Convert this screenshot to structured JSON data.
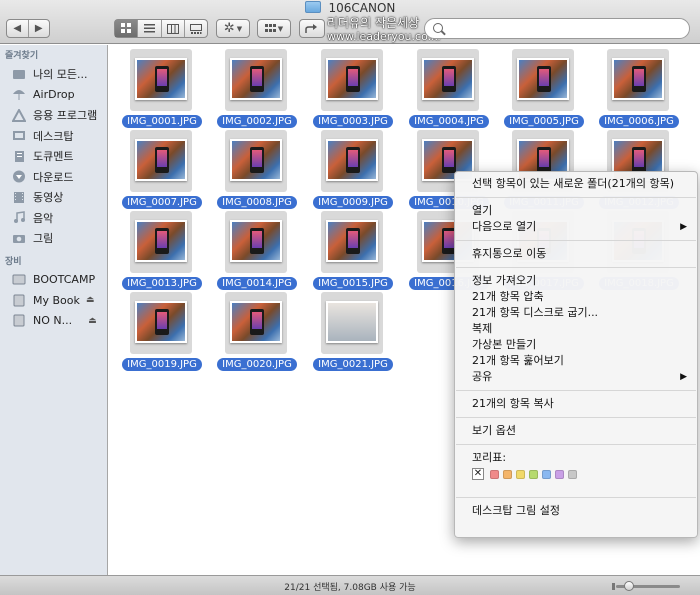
{
  "window": {
    "title": "106CANON"
  },
  "toolbar": {
    "back_icon": "◀",
    "forward_icon": "▶",
    "views": [
      "grid",
      "list",
      "columns",
      "coverflow"
    ],
    "action_icon": "gear",
    "arrange_icon": "grid-arrange",
    "share_icon": "share",
    "watermark_line1": "리더유의 작은세상",
    "watermark_line2": "www.leaderyou.co.kr"
  },
  "sidebar": {
    "favorites_header": "즐겨찾기",
    "favorites": [
      {
        "label": "나의 모든...",
        "icon": "all-files-icon"
      },
      {
        "label": "AirDrop",
        "icon": "airdrop-icon"
      },
      {
        "label": "응용 프로그램",
        "icon": "applications-icon"
      },
      {
        "label": "데스크탑",
        "icon": "desktop-icon"
      },
      {
        "label": "도큐멘트",
        "icon": "documents-icon"
      },
      {
        "label": "다운로드",
        "icon": "downloads-icon"
      },
      {
        "label": "동영상",
        "icon": "movies-icon"
      },
      {
        "label": "음악",
        "icon": "music-icon"
      },
      {
        "label": "그림",
        "icon": "pictures-icon"
      }
    ],
    "devices_header": "장비",
    "devices": [
      {
        "label": "BOOTCAMP",
        "eject": false
      },
      {
        "label": "My Book",
        "eject": true
      },
      {
        "label": "NO N...",
        "eject": true
      }
    ]
  },
  "files": [
    "IMG_0001.JPG",
    "IMG_0002.JPG",
    "IMG_0003.JPG",
    "IMG_0004.JPG",
    "IMG_0005.JPG",
    "IMG_0006.JPG",
    "IMG_0007.JPG",
    "IMG_0008.JPG",
    "IMG_0009.JPG",
    "IMG_0010.JPG",
    "IMG_0011.JPG",
    "IMG_0012.JPG",
    "IMG_0013.JPG",
    "IMG_0014.JPG",
    "IMG_0015.JPG",
    "IMG_0016.JPG",
    "IMG_0017.JPG",
    "IMG_0018.JPG",
    "IMG_0019.JPG",
    "IMG_0020.JPG",
    "IMG_0021.JPG"
  ],
  "context_menu": {
    "new_folder": "선택 항목이 있는 새로운 폴더(21개의 항목)",
    "open": "열기",
    "open_with": "다음으로 열기",
    "move_to_trash": "휴지통으로 이동",
    "get_info": "정보 가져오기",
    "compress": "21개 항목 압축",
    "burn": "21개 항목 디스크로 굽기...",
    "duplicate": "복제",
    "make_alias": "가상본 만들기",
    "quick_look": "21개 항목 훑어보기",
    "share": "공유",
    "copy": "21개의 항목 복사",
    "view_options": "보기 옵션",
    "tags_label": "꼬리표:",
    "tag_colors": [
      "#f08a8a",
      "#f4b56a",
      "#f1d96a",
      "#b6da6e",
      "#8ab8f0",
      "#c9a0e6",
      "#c8c8c8"
    ],
    "set_desktop_picture": "데스크탑 그림 설정"
  },
  "status": {
    "text": "21/21 선택됨, 7.08GB 사용 가능"
  }
}
